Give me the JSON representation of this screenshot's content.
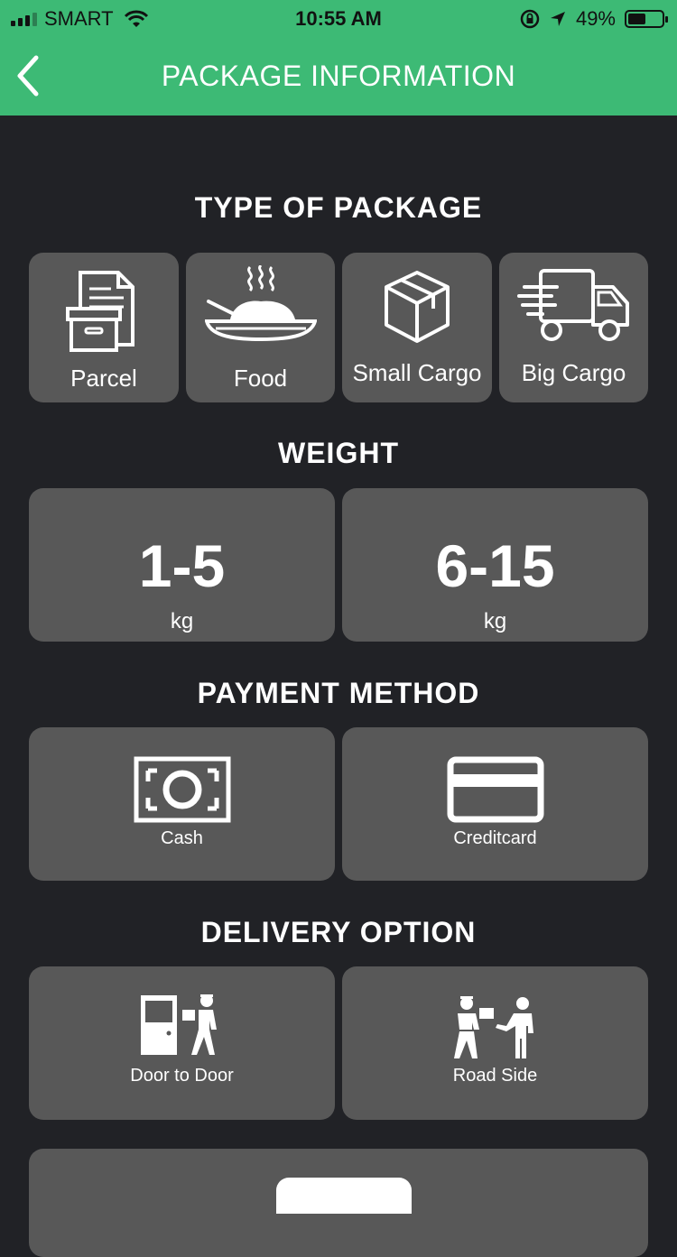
{
  "status_bar": {
    "carrier": "SMART",
    "time": "10:55 AM",
    "battery": "49%",
    "battery_level": 0.49
  },
  "header": {
    "title": "PACKAGE INFORMATION"
  },
  "sections": {
    "package_type": {
      "title": "TYPE OF PACKAGE",
      "options": [
        "Parcel",
        "Food",
        "Small Cargo",
        "Big Cargo"
      ]
    },
    "weight": {
      "title": "WEIGHT",
      "options": [
        {
          "value": "1-5",
          "unit": "kg"
        },
        {
          "value": "6-15",
          "unit": "kg"
        }
      ]
    },
    "payment": {
      "title": "PAYMENT METHOD",
      "options": [
        "Cash",
        "Creditcard"
      ]
    },
    "delivery": {
      "title": "DELIVERY OPTION",
      "options": [
        "Door to Door",
        "Road Side"
      ]
    }
  },
  "colors": {
    "header": "#3dba75",
    "background": "#212226",
    "tile": "#585858"
  }
}
